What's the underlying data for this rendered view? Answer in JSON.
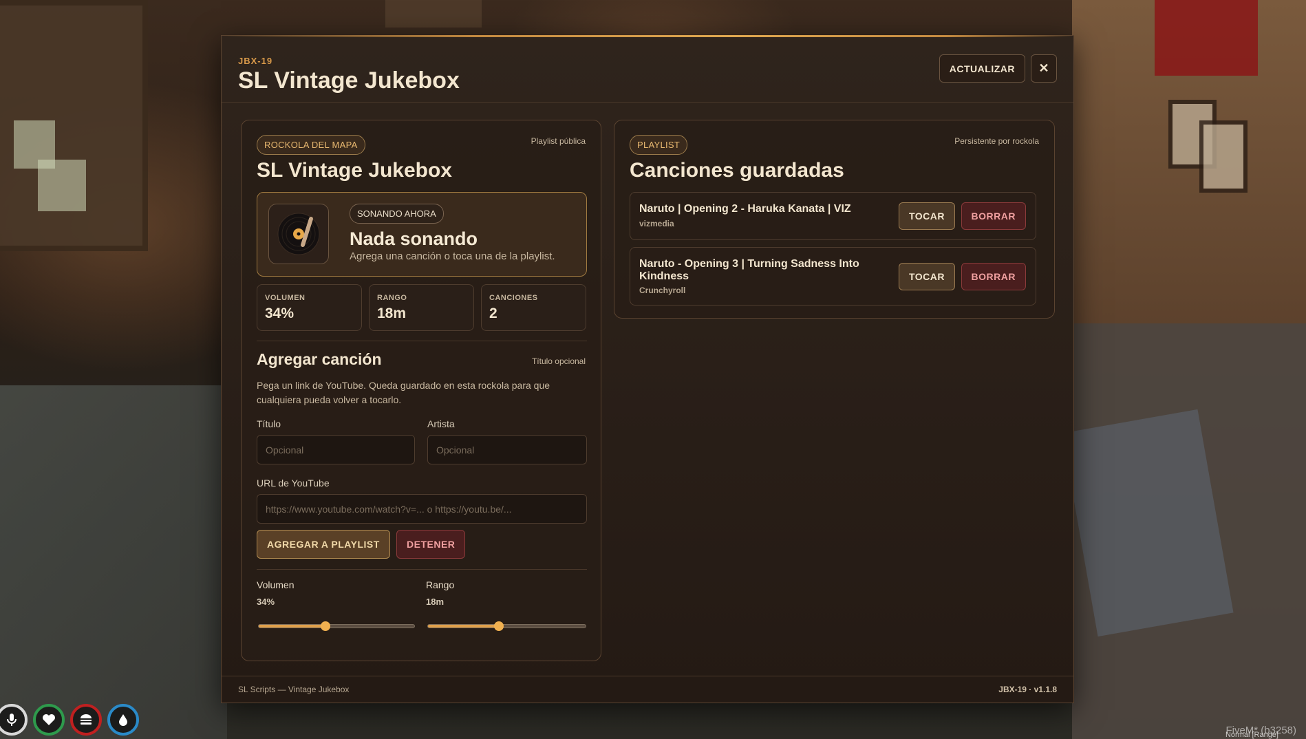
{
  "modal": {
    "code": "JBX-19",
    "title": "SL Vintage Jukebox",
    "refresh_label": "ACTUALIZAR",
    "close_label": "✕"
  },
  "left": {
    "pill": "ROCKOLA DEL MAPA",
    "meta": "Playlist pública",
    "title": "SL Vintage Jukebox",
    "now_playing": {
      "pill": "SONANDO AHORA",
      "title": "Nada sonando",
      "subtitle": "Agrega una canción o toca una de la playlist."
    },
    "stats": [
      {
        "label": "VOLUMEN",
        "value": "34%"
      },
      {
        "label": "RANGO",
        "value": "18m"
      },
      {
        "label": "CANCIONES",
        "value": "2"
      }
    ],
    "add": {
      "title": "Agregar canción",
      "meta": "Título opcional",
      "description": "Pega un link de YouTube. Queda guardado en esta rockola para que cualquiera pueda volver a tocarlo.",
      "title_label": "Título",
      "title_placeholder": "Opcional",
      "artist_label": "Artista",
      "artist_placeholder": "Opcional",
      "url_label": "URL de YouTube",
      "url_placeholder": "https://www.youtube.com/watch?v=... o https://youtu.be/...",
      "add_button": "AGREGAR A PLAYLIST",
      "stop_button": "DETENER"
    },
    "sliders": {
      "volume_label": "Volumen",
      "volume_value": "34%",
      "volume_fraction": 0.43,
      "range_label": "Rango",
      "range_value": "18m",
      "range_fraction": 0.45
    }
  },
  "right": {
    "pill": "PLAYLIST",
    "meta": "Persistente por rockola",
    "title": "Canciones guardadas",
    "songs": [
      {
        "title": "Naruto | Opening 2 - Haruka Kanata | VIZ",
        "artist": "vizmedia",
        "play": "TOCAR",
        "delete": "BORRAR"
      },
      {
        "title": "Naruto - Opening 3 | Turning Sadness Into Kindness",
        "artist": "Crunchyroll",
        "play": "TOCAR",
        "delete": "BORRAR"
      }
    ]
  },
  "footer": {
    "left": "SL Scripts — Vintage Jukebox",
    "right": "JBX-19 · v1.1.8"
  },
  "overlay": {
    "fivem": "FiveM* (b3258)",
    "fivem_sub": "Normal [Range]"
  },
  "colors": {
    "accent": "#e0a04a",
    "danger": "#f0a0a0",
    "panel": "#241a14"
  }
}
